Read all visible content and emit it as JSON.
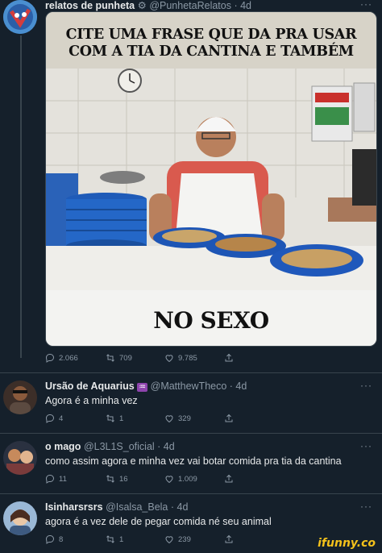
{
  "colors": {
    "background": "#15202b",
    "text": "#e7e9ea",
    "muted": "#8b98a5",
    "divider": "#38444d",
    "watermark": "#f5c21b"
  },
  "main_tweet": {
    "display_name": "relatos de punheta",
    "handle": "@PunhetaRelatos",
    "time": "· 4d",
    "more": "···",
    "meme_top_text_line1": "CITE UMA FRASE QUE DA PRA USAR",
    "meme_top_text_line2": "COM A TIA DA CANTINA E TAMBÉM",
    "meme_bottom_text": "NO SEXO",
    "stats": {
      "replies": "2.066",
      "retweets": "709",
      "likes": "9.785"
    }
  },
  "replies": [
    {
      "display_name": "Ursão de Aquarius",
      "emoji": "♒",
      "handle": "@MatthewTheco",
      "time": "· 4d",
      "text": "Agora é a minha vez",
      "stats": {
        "replies": "4",
        "retweets": "1",
        "likes": "329"
      }
    },
    {
      "display_name": "o mago",
      "handle": "@L3L1S_oficial",
      "time": "· 4d",
      "text": "como assim agora e minha vez vai botar comida pra tia da cantina",
      "stats": {
        "replies": "11",
        "retweets": "16",
        "likes": "1.009"
      }
    },
    {
      "display_name": "Isinharsrsrs",
      "handle": "@Isalsa_Bela",
      "time": "· 4d",
      "text": "agora é a vez dele de pegar comida né seu animal",
      "stats": {
        "replies": "8",
        "retweets": "1",
        "likes": "239"
      }
    }
  ],
  "watermark": "ifunny.co",
  "icons": [
    "reply-icon",
    "retweet-icon",
    "like-icon",
    "share-icon",
    "more-icon"
  ]
}
